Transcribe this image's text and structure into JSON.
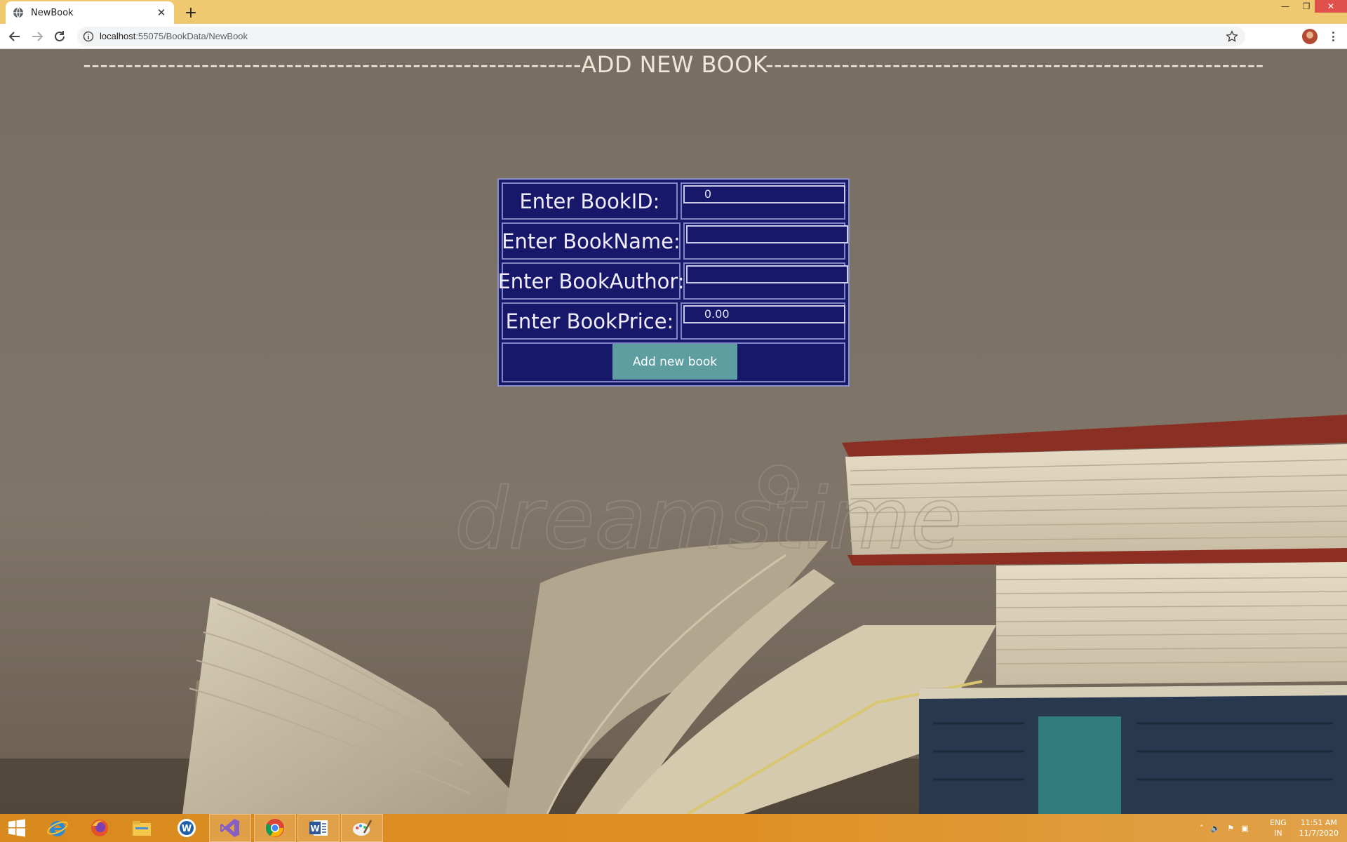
{
  "browser": {
    "tab_title": "NewBook",
    "url_host": "localhost",
    "url_path": ":55075/BookData/NewBook"
  },
  "page": {
    "heading": "-----------------------------------------------------------ADD NEW BOOK-----------------------------------------------------------",
    "form": {
      "rows": [
        {
          "label": "Enter BookID:",
          "value": "0"
        },
        {
          "label": "Enter BookName:",
          "value": ""
        },
        {
          "label": "Enter BookAuthor:",
          "value": ""
        },
        {
          "label": "Enter BookPrice:",
          "value": "0.00"
        }
      ],
      "submit_label": "Add new book"
    },
    "watermark": "dreamstime"
  },
  "taskbar": {
    "apps": [
      "start-icon",
      "internet-explorer-icon",
      "firefox-icon",
      "file-explorer-icon",
      "app-w-icon",
      "visual-studio-icon",
      "chrome-icon",
      "word-icon",
      "paint-icon"
    ],
    "language": "ENG",
    "region": "IN",
    "time": "11:51 AM",
    "date": "11/7/2020"
  },
  "colors": {
    "form_bg": "#18186a",
    "form_border": "#7f84c2",
    "button_bg": "#5f9ea0",
    "tabstrip": "#f0c870",
    "taskbar": "#de9024"
  }
}
